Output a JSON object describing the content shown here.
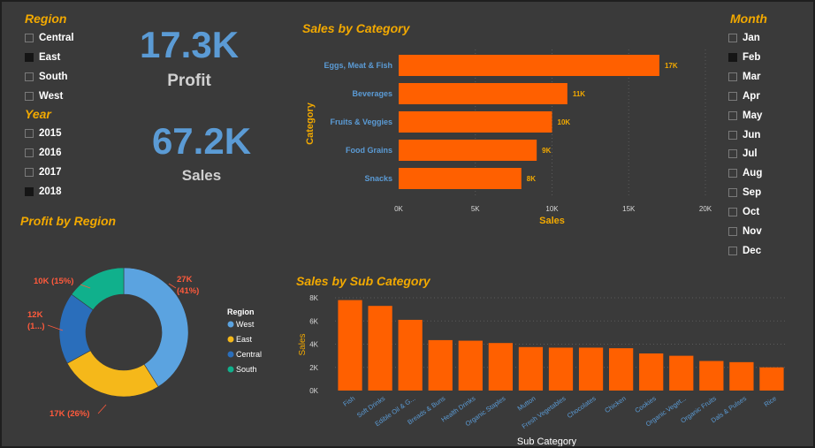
{
  "region_slicer": {
    "title": "Region",
    "items": [
      {
        "label": "Central",
        "selected": false
      },
      {
        "label": "East",
        "selected": true
      },
      {
        "label": "South",
        "selected": false
      },
      {
        "label": "West",
        "selected": false
      }
    ]
  },
  "year_slicer": {
    "title": "Year",
    "items": [
      {
        "label": "2015",
        "selected": false
      },
      {
        "label": "2016",
        "selected": false
      },
      {
        "label": "2017",
        "selected": false
      },
      {
        "label": "2018",
        "selected": true
      }
    ]
  },
  "month_slicer": {
    "title": "Month",
    "items": [
      {
        "label": "Jan",
        "selected": false
      },
      {
        "label": "Feb",
        "selected": true
      },
      {
        "label": "Mar",
        "selected": false
      },
      {
        "label": "Apr",
        "selected": false
      },
      {
        "label": "May",
        "selected": false
      },
      {
        "label": "Jun",
        "selected": false
      },
      {
        "label": "Jul",
        "selected": false
      },
      {
        "label": "Aug",
        "selected": false
      },
      {
        "label": "Sep",
        "selected": false
      },
      {
        "label": "Oct",
        "selected": false
      },
      {
        "label": "Nov",
        "selected": false
      },
      {
        "label": "Dec",
        "selected": false
      }
    ]
  },
  "cards": {
    "profit": {
      "value": "17.3K",
      "label": "Profit"
    },
    "sales": {
      "value": "67.2K",
      "label": "Sales"
    }
  },
  "colors": {
    "background": "#3a3a3a",
    "accent_title": "#f2a900",
    "bar": "#ff6000",
    "card_value": "#5b9bd5",
    "axis_text": "#5b9bd5"
  },
  "chart_data": [
    {
      "type": "bar",
      "orientation": "horizontal",
      "title": "Sales by Category",
      "xlabel": "Sales",
      "ylabel": "Category",
      "categories": [
        "Eggs, Meat & Fish",
        "Beverages",
        "Fruits & Veggies",
        "Food Grains",
        "Snacks"
      ],
      "values": [
        17000,
        11000,
        10000,
        9000,
        8000
      ],
      "data_labels": [
        "17K",
        "11K",
        "10K",
        "9K",
        "8K"
      ],
      "xlim": [
        0,
        20000
      ],
      "xticks": [
        "0K",
        "5K",
        "10K",
        "15K",
        "20K"
      ],
      "grid": true
    },
    {
      "type": "pie",
      "title": "Profit by Region",
      "legend_title": "Region",
      "legend_position": "right",
      "labels": [
        "West",
        "East",
        "Central",
        "South"
      ],
      "values": [
        41,
        26,
        18,
        15
      ],
      "colors": [
        "#5ba3e0",
        "#f5b81a",
        "#2a6ebb",
        "#10b08c"
      ],
      "data_labels": [
        "27K\n(41%)",
        "17K (26%)",
        "12K\n(1...)",
        "10K (15%)"
      ]
    },
    {
      "type": "bar",
      "orientation": "vertical",
      "title": "Sales by Sub Category",
      "xlabel": "Sub Category",
      "ylabel": "Sales",
      "categories": [
        "Fish",
        "Soft Drinks",
        "Edible Oil & G...",
        "Breads & Buns",
        "Health Drinks",
        "Organic Staples",
        "Mutton",
        "Fresh Vegetables",
        "Chocolates",
        "Chicken",
        "Cookies",
        "Organic Veget...",
        "Organic Fruits",
        "Dals & Pulses",
        "Rice"
      ],
      "values": [
        7800,
        7300,
        6100,
        4350,
        4300,
        4100,
        3750,
        3700,
        3700,
        3650,
        3200,
        3000,
        2550,
        2450,
        2000
      ],
      "ylim": [
        0,
        8000
      ],
      "yticks": [
        "0K",
        "2K",
        "4K",
        "6K",
        "8K"
      ],
      "grid": true
    }
  ]
}
